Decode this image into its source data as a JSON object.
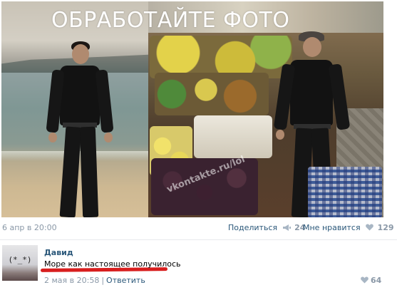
{
  "photo": {
    "title": "ОБРАБОТАЙТЕ ФОТО",
    "watermark": "vkontakte.ru/lol"
  },
  "post": {
    "date": "6 апр в 20:00",
    "share_label": "Поделиться",
    "share_count": "24",
    "like_label": "Мне нравится",
    "like_count": "129"
  },
  "comment": {
    "author": "Давид",
    "avatar_text": "(*_*)",
    "text": "Море как настоящее получилось",
    "date": "2 мая в 20:58",
    "separator": "|",
    "reply_label": "Ответить",
    "like_count": "64"
  },
  "colors": {
    "link": "#2b587a",
    "muted": "#8a98a7",
    "highlight": "#d81e1e"
  },
  "icons": [
    "megaphone-icon",
    "heart-icon"
  ]
}
